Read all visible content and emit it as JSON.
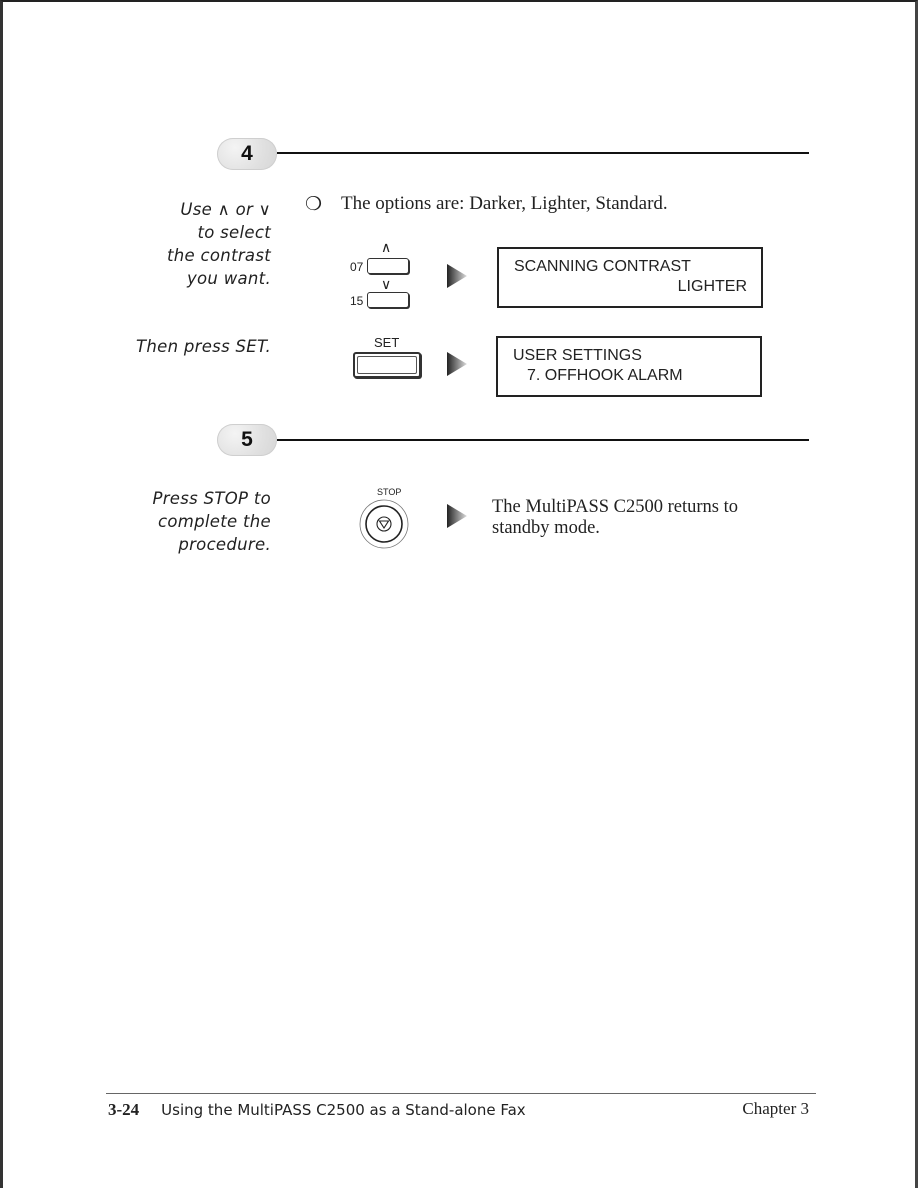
{
  "steps": [
    {
      "number": "4",
      "instructions": [
        {
          "note_lines": [
            "Use ∧ or ∨",
            "to select",
            "the contrast",
            "you want."
          ],
          "bullet_icon": "circle-bullet",
          "bullet_text": "The options are: Darker, Lighter, Standard.",
          "keys": {
            "up_symbol": "∧",
            "down_symbol": "∨",
            "up_key_number": "07",
            "down_key_number": "15"
          },
          "display": {
            "line1": "SCANNING CONTRAST",
            "line2": "LIGHTER"
          }
        },
        {
          "note_lines": [
            "Then press SET."
          ],
          "key_label": "SET",
          "display": {
            "line1": "USER SETTINGS",
            "line2": "7. OFFHOOK ALARM"
          }
        }
      ]
    },
    {
      "number": "5",
      "instructions": [
        {
          "note_lines": [
            "Press STOP to",
            "complete the",
            "procedure."
          ],
          "key_label": "STOP",
          "result_lines": [
            "The MultiPASS C2500 returns to",
            "standby mode."
          ]
        }
      ]
    }
  ],
  "footer": {
    "page_number": "3-24",
    "section_title": "Using the MultiPASS C2500 as a Stand-alone Fax",
    "chapter": "Chapter 3"
  }
}
